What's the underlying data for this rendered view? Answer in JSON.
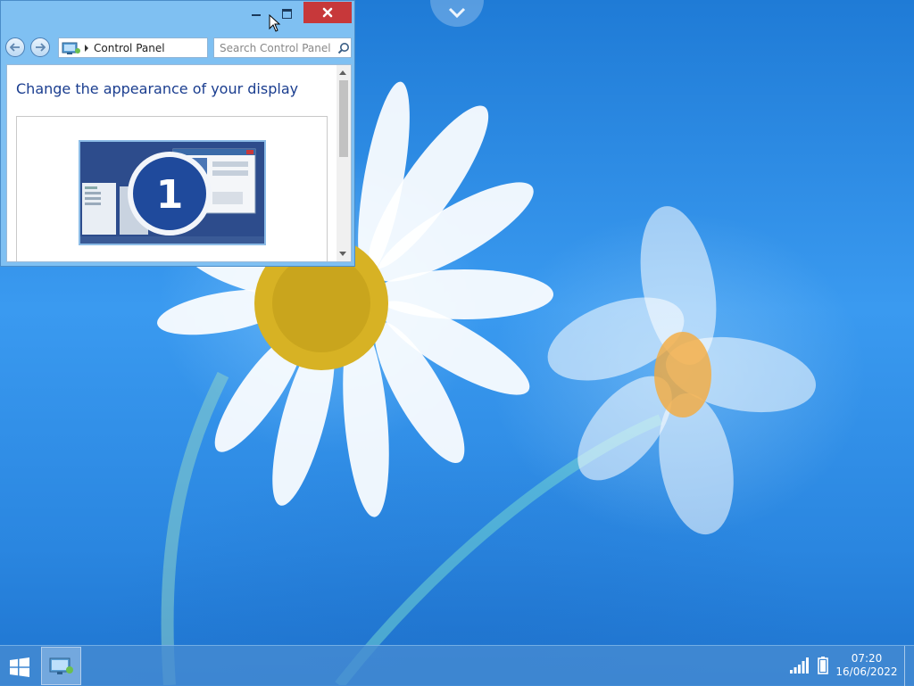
{
  "window": {
    "title_controls": {
      "minimize": "minimize",
      "maximize": "maximize",
      "close": "close"
    },
    "address": {
      "location": "Control Panel"
    },
    "search": {
      "placeholder": "Search Control Panel"
    },
    "content": {
      "heading": "Change the appearance of your display",
      "monitor_number": "1"
    }
  },
  "taskbar": {
    "clock_time": "07:20",
    "clock_date": "16/06/2022",
    "items": [
      {
        "name": "Control Panel",
        "active": true
      }
    ]
  },
  "colors": {
    "close_button": "#c7383a",
    "heading_text": "#1a3d8f",
    "desktop_sky": "#2f8be0"
  }
}
